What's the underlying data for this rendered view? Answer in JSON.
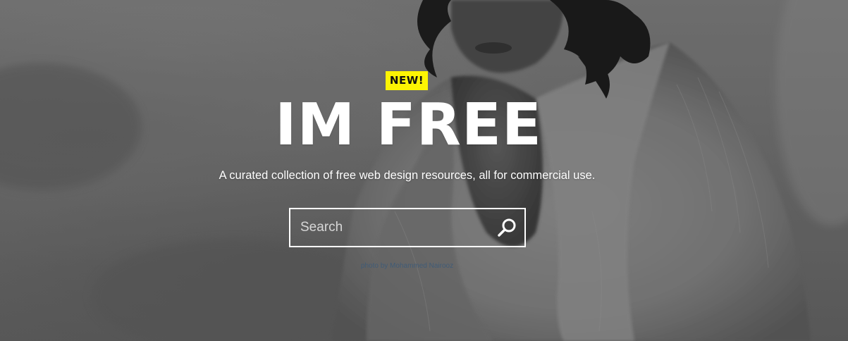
{
  "hero": {
    "badge_label": "NEW!",
    "title": "IM FREE",
    "subtitle": "A curated collection of free web design resources, all for commercial use."
  },
  "search": {
    "placeholder": "Search",
    "value": "",
    "icon": "search-icon"
  },
  "credit": {
    "text": "photo by Mohammed Nairooz"
  },
  "colors": {
    "badge_background": "#fcf403",
    "badge_text": "#111111",
    "title_text": "#ffffff",
    "credit_link": "#3a5a7a"
  },
  "background": {
    "description_icon": "photo-background",
    "tone": "grayscale"
  }
}
